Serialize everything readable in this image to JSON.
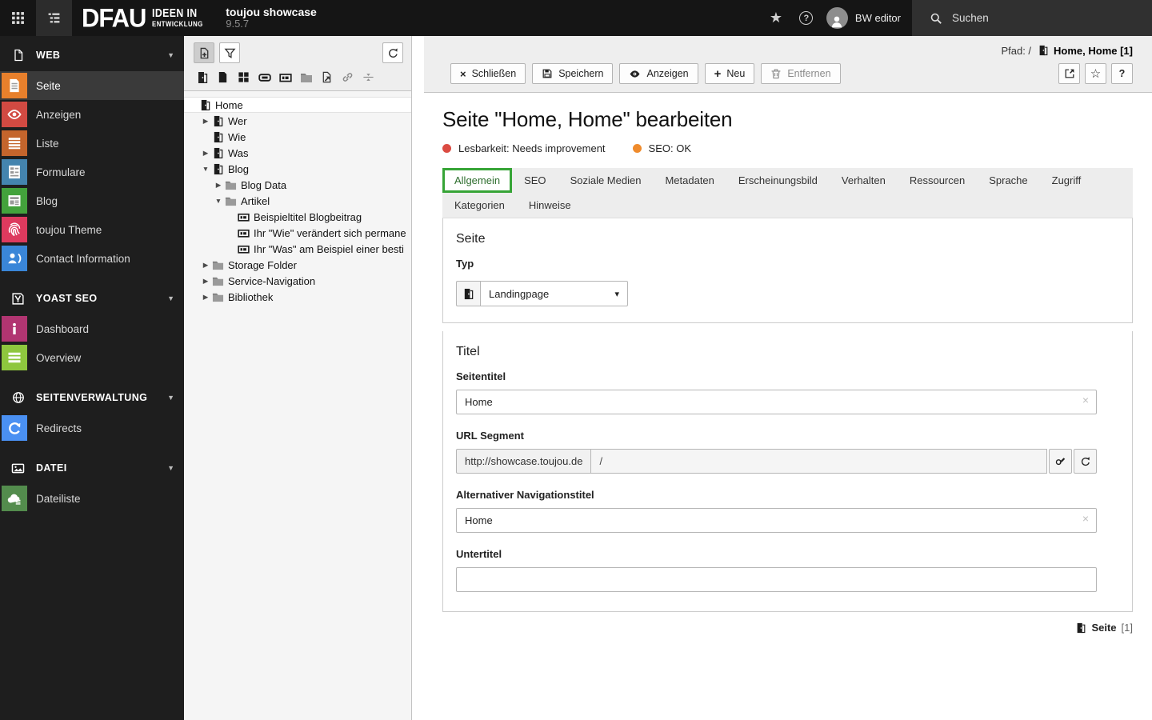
{
  "topbar": {
    "logo_main": "DFAU",
    "logo_line1": "IDEEN IN",
    "logo_line2": "ENTWICKLUNG",
    "site_title": "toujou showcase",
    "site_version": "9.5.7",
    "username": "BW editor",
    "search_label": "Suchen"
  },
  "sidebar": {
    "groups": [
      {
        "label": "WEB",
        "items": [
          {
            "label": "Seite",
            "color": "#e8802c"
          },
          {
            "label": "Anzeigen",
            "color": "#d24a42"
          },
          {
            "label": "Liste",
            "color": "#c4652c"
          },
          {
            "label": "Formulare",
            "color": "#4484ae"
          },
          {
            "label": "Blog",
            "color": "#43a23c"
          },
          {
            "label": "toujou Theme",
            "color": "#dd3a5e"
          },
          {
            "label": "Contact Information",
            "color": "#3a86d8"
          }
        ]
      },
      {
        "label": "YOAST SEO",
        "items": [
          {
            "label": "Dashboard",
            "color": "#b13571"
          },
          {
            "label": "Overview",
            "color": "#8ec73e"
          }
        ]
      },
      {
        "label": "SEITENVERWALTUNG",
        "items": [
          {
            "label": "Redirects",
            "color": "#4a90f2"
          }
        ]
      },
      {
        "label": "DATEI",
        "items": [
          {
            "label": "Dateiliste",
            "color": "#538c4d"
          }
        ]
      }
    ]
  },
  "tree": {
    "items": [
      {
        "label": "Home"
      },
      {
        "label": "Wer"
      },
      {
        "label": "Wie"
      },
      {
        "label": "Was"
      },
      {
        "label": "Blog"
      },
      {
        "label": "Blog Data"
      },
      {
        "label": "Artikel"
      },
      {
        "label": "Beispieltitel Blogbeitrag"
      },
      {
        "label": "Ihr \"Wie\" verändert sich permane"
      },
      {
        "label": "Ihr \"Was\" am Beispiel einer besti"
      },
      {
        "label": "Storage Folder"
      },
      {
        "label": "Service-Navigation"
      },
      {
        "label": "Bibliothek"
      }
    ]
  },
  "docheader": {
    "path_label": "Pfad: /",
    "path_value": "Home, Home [1]",
    "btn_close": "Schließen",
    "btn_save": "Speichern",
    "btn_view": "Anzeigen",
    "btn_new": "Neu",
    "btn_delete": "Entfernen",
    "btn_help": "?"
  },
  "content": {
    "title": "Seite \"Home, Home\" bearbeiten",
    "status": [
      {
        "label": "Lesbarkeit: Needs improvement",
        "color": "#db4b42"
      },
      {
        "label": "SEO: OK",
        "color": "#ef8b2c"
      }
    ],
    "tabs_row1": [
      "Allgemein",
      "SEO",
      "Soziale Medien",
      "Metadaten",
      "Erscheinungsbild",
      "Verhalten",
      "Ressourcen",
      "Sprache",
      "Zugriff"
    ],
    "tabs_row2": [
      "Kategorien",
      "Hinweise"
    ],
    "active_tab_color": "#36a436",
    "section_page": {
      "heading": "Seite",
      "typ_label": "Typ",
      "typ_value": "Landingpage"
    },
    "section_title": {
      "heading": "Titel",
      "seitentitel_label": "Seitentitel",
      "seitentitel_value": "Home",
      "url_label": "URL Segment",
      "url_prefix": "http://showcase.toujou.de",
      "url_value": "/",
      "nav_label": "Alternativer Navigationstitel",
      "nav_value": "Home",
      "untertitel_label": "Untertitel",
      "untertitel_value": ""
    },
    "footer": {
      "type_label": "Seite",
      "count": "[1]"
    }
  }
}
